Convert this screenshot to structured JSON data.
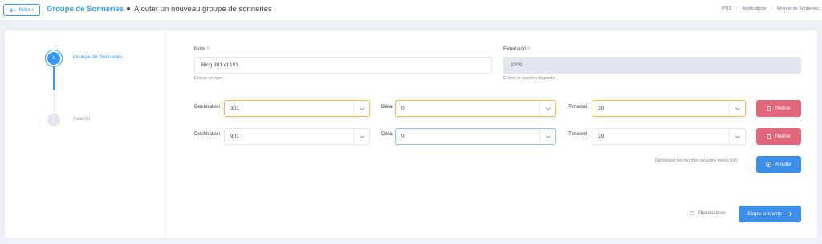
{
  "header": {
    "back_label": "Retour",
    "title": "Groupe de Sonneries",
    "subtitle": "Ajouter un nouveau groupe de sonneries",
    "breadcrumb": [
      "PBX",
      "Applications",
      "Groupe de Sonneries"
    ]
  },
  "stepper": {
    "steps": [
      {
        "number": "1",
        "label": "Groupe de Sonneries",
        "active": true
      },
      {
        "number": "2",
        "label": "Avancé",
        "active": false
      }
    ]
  },
  "form": {
    "name": {
      "label": "Nom",
      "required_mark": "*",
      "value": "Ring 301 et 101",
      "help": "Entrez un nom."
    },
    "extension": {
      "label": "Extension",
      "required_mark": "*",
      "value": "3209",
      "help": "Entrez le numéro du poste."
    },
    "rows": [
      {
        "destination_label": "Destination",
        "destination": "301",
        "delay_label": "Délai",
        "delay": "0",
        "timeout_label": "Timeout",
        "timeout": "30",
        "remove_label": "Retirer"
      },
      {
        "destination_label": "Destination",
        "destination": "901",
        "delay_label": "Délai",
        "delay": "0",
        "timeout_label": "Timeout",
        "timeout": "30",
        "remove_label": "Retirer"
      }
    ],
    "ivr_hint": "Définissez les touches de votre menu SVI.",
    "add_label": "Ajouter",
    "reset_label": "Réinitialiser",
    "next_label": "Etape suivante"
  },
  "colors": {
    "primary": "#3699ff",
    "danger": "#e0687a",
    "focus_warning": "#ffb547",
    "background": "#eef0f8"
  },
  "icons": [
    "arrow-left-icon",
    "chevron-down-icon",
    "trash-icon",
    "plus-circle-icon",
    "refresh-icon",
    "arrow-right-icon"
  ]
}
